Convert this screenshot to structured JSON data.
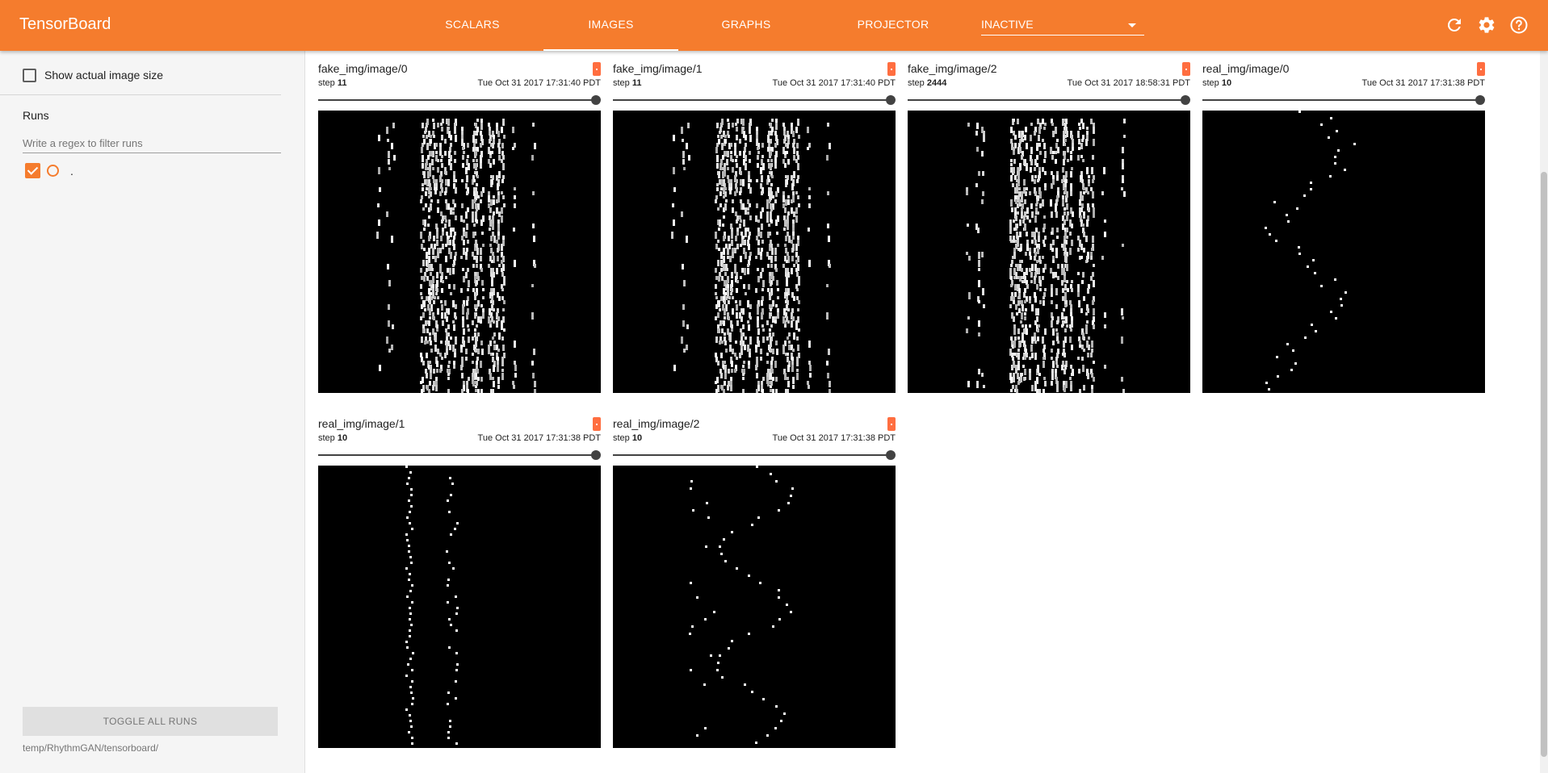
{
  "app": {
    "title": "TensorBoard"
  },
  "tabs": [
    {
      "label": "SCALARS",
      "active": false
    },
    {
      "label": "IMAGES",
      "active": true
    },
    {
      "label": "GRAPHS",
      "active": false
    },
    {
      "label": "PROJECTOR",
      "active": false
    }
  ],
  "inactive_dropdown": {
    "selected": "INACTIVE"
  },
  "toolbar": {
    "icons": [
      "refresh-icon",
      "gear-icon",
      "help-icon"
    ]
  },
  "sidebar": {
    "show_actual_size_label": "Show actual image size",
    "runs_title": "Runs",
    "regex_placeholder": "Write a regex to filter runs",
    "runs": [
      {
        "name": ".",
        "checked": true
      }
    ],
    "toggle_all_label": "TOGGLE ALL RUNS",
    "logdir": "temp/RhythmGAN/tensorboard/"
  },
  "cards": [
    {
      "title": "fake_img/image/0",
      "step_label": "step",
      "step": "11",
      "wall_time": "Tue Oct 31 2017 17:31:40 PDT",
      "kind": "fake"
    },
    {
      "title": "fake_img/image/1",
      "step_label": "step",
      "step": "11",
      "wall_time": "Tue Oct 31 2017 17:31:40 PDT",
      "kind": "fake"
    },
    {
      "title": "fake_img/image/2",
      "step_label": "step",
      "step": "2444",
      "wall_time": "Tue Oct 31 2017 18:58:31 PDT",
      "kind": "fake"
    },
    {
      "title": "real_img/image/0",
      "step_label": "step",
      "step": "10",
      "wall_time": "Tue Oct 31 2017 17:31:38 PDT",
      "kind": "real"
    },
    {
      "title": "real_img/image/1",
      "step_label": "step",
      "step": "10",
      "wall_time": "Tue Oct 31 2017 17:31:38 PDT",
      "kind": "real"
    },
    {
      "title": "real_img/image/2",
      "step_label": "step",
      "step": "10",
      "wall_time": "Tue Oct 31 2017 17:31:38 PDT",
      "kind": "real"
    }
  ],
  "colors": {
    "accent": "#f57c2d",
    "expand_button": "#ff6e40"
  }
}
